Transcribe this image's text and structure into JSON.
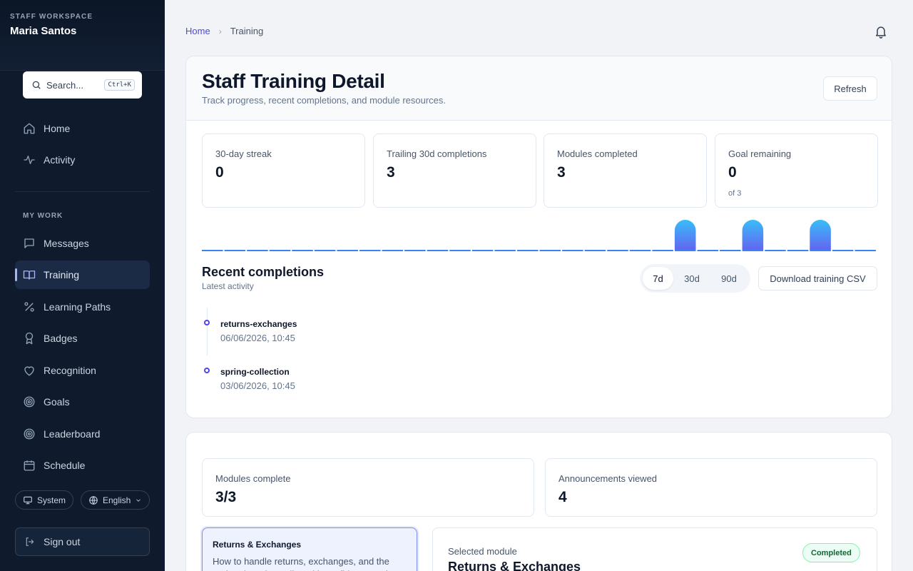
{
  "sidebar": {
    "eyebrow": "STAFF WORKSPACE",
    "user_name": "Maria Santos",
    "search": {
      "placeholder": "Search...",
      "shortcut": "Ctrl+K"
    },
    "primary_nav": [
      {
        "label": "Home",
        "icon": "home-icon"
      },
      {
        "label": "Activity",
        "icon": "activity-icon"
      }
    ],
    "section_label": "MY WORK",
    "work_nav": [
      {
        "label": "Messages",
        "icon": "message-icon",
        "active": false
      },
      {
        "label": "Training",
        "icon": "book-icon",
        "active": true
      },
      {
        "label": "Learning Paths",
        "icon": "percent-icon",
        "active": false
      },
      {
        "label": "Badges",
        "icon": "award-icon",
        "active": false
      },
      {
        "label": "Recognition",
        "icon": "heart-icon",
        "active": false
      },
      {
        "label": "Goals",
        "icon": "target-icon",
        "active": false
      },
      {
        "label": "Leaderboard",
        "icon": "target-icon",
        "active": false
      },
      {
        "label": "Schedule",
        "icon": "calendar-icon",
        "active": false
      }
    ],
    "theme_label": "System",
    "language_label": "English",
    "sign_out_label": "Sign out"
  },
  "breadcrumb": {
    "home": "Home",
    "current": "Training"
  },
  "header": {
    "title": "Staff Training Detail",
    "subtitle": "Track progress, recent completions, and module resources.",
    "refresh_label": "Refresh"
  },
  "stats": [
    {
      "label": "30-day streak",
      "value": "0",
      "sub": ""
    },
    {
      "label": "Trailing 30d completions",
      "value": "3",
      "sub": ""
    },
    {
      "label": "Modules completed",
      "value": "3",
      "sub": ""
    },
    {
      "label": "Goal remaining",
      "value": "0",
      "sub": "of 3"
    }
  ],
  "chart_data": {
    "type": "bar",
    "title": "",
    "values": [
      0,
      0,
      0,
      0,
      0,
      0,
      0,
      0,
      0,
      0,
      0,
      0,
      0,
      0,
      0,
      0,
      0,
      0,
      0,
      0,
      0,
      1,
      0,
      0,
      1,
      0,
      0,
      1,
      0,
      0
    ],
    "ylim": [
      0,
      1
    ],
    "colors": {
      "bar_top": "#38bdf8",
      "bar_bottom": "#6366f1",
      "baseline": "#3b82f6"
    }
  },
  "recent": {
    "title": "Recent completions",
    "subtitle": "Latest activity",
    "ranges": [
      "7d",
      "30d",
      "90d"
    ],
    "active_range": "7d",
    "download_label": "Download training CSV",
    "items": [
      {
        "name": "returns-exchanges",
        "date": "06/06/2026, 10:45"
      },
      {
        "name": "spring-collection",
        "date": "03/06/2026, 10:45"
      }
    ]
  },
  "modules": {
    "stats": [
      {
        "label": "Modules complete",
        "value": "3/3"
      },
      {
        "label": "Announcements viewed",
        "value": "4"
      }
    ],
    "card": {
      "title": "Returns & Exchanges",
      "desc": "How to handle returns, exchanges, and the updated 30-day policy with confidence and"
    },
    "selected": {
      "label": "Selected module",
      "title": "Returns & Exchanges",
      "status": "Completed"
    }
  },
  "colors": {
    "accent": "#4f46e5",
    "sidebar_bg": "#0f1b2d",
    "success": "#166534"
  }
}
